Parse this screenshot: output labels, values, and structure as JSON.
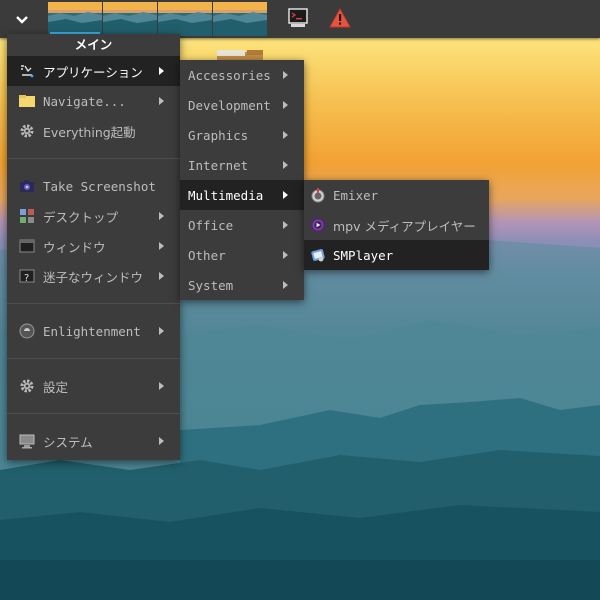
{
  "menu_main": {
    "title": "メイン",
    "items": [
      {
        "label": "アプリケーション",
        "icon": "applications-icon",
        "submenu": true,
        "active": true
      },
      {
        "label": "Navigate...",
        "icon": "folder-icon",
        "submenu": true
      },
      {
        "label": "Everything起動",
        "icon": "gear-icon",
        "submenu": false
      },
      {
        "label": "Take Screenshot",
        "icon": "camera-icon",
        "submenu": false
      },
      {
        "label": "デスクトップ",
        "icon": "desktop-icon",
        "submenu": true
      },
      {
        "label": "ウィンドウ",
        "icon": "window-icon",
        "submenu": true
      },
      {
        "label": "迷子なウィンドウ",
        "icon": "lost-window-icon",
        "submenu": true
      },
      {
        "label": "Enlightenment",
        "icon": "enlightenment-icon",
        "submenu": true
      },
      {
        "label": "設定",
        "icon": "settings-gear-icon",
        "submenu": true
      },
      {
        "label": "システム",
        "icon": "computer-icon",
        "submenu": true
      }
    ]
  },
  "menu_applications": {
    "items": [
      {
        "label": "Accessories"
      },
      {
        "label": "Development"
      },
      {
        "label": "Graphics"
      },
      {
        "label": "Internet"
      },
      {
        "label": "Multimedia",
        "active": true
      },
      {
        "label": "Office"
      },
      {
        "label": "Other"
      },
      {
        "label": "System"
      }
    ]
  },
  "menu_multimedia": {
    "items": [
      {
        "label": "Emixer",
        "icon": "mixer-icon"
      },
      {
        "label": "mpv メディアプレイヤー",
        "icon": "mpv-icon"
      },
      {
        "label": "SMPlayer",
        "icon": "smplayer-icon",
        "active": true
      }
    ]
  },
  "shelf": {
    "start_icon": "chevron-down-icon",
    "pager_desks": 4,
    "active_desk": 0,
    "tray": [
      "terminal-icon",
      "warning-icon"
    ]
  },
  "colors": {
    "shelf": "#3b3b3b",
    "menu": "#3c3c3c",
    "menu_active": "#222222",
    "accent": "#3daee9",
    "warning": "#da4453"
  }
}
